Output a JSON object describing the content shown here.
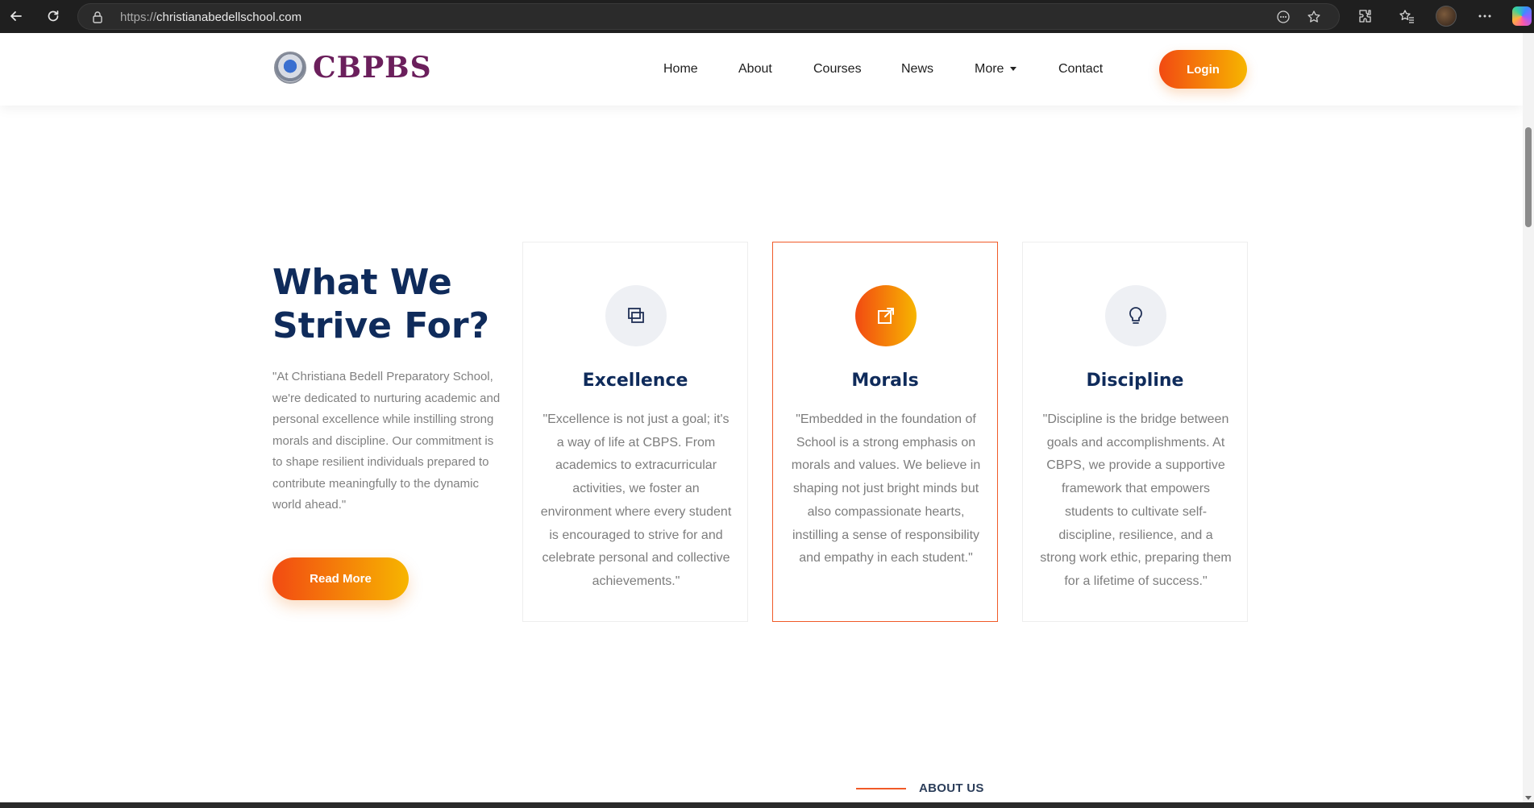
{
  "browser": {
    "url_protocol": "https://",
    "url_host": "christianabedellschool.com",
    "icons": [
      "back-icon",
      "reload-icon",
      "lock-icon",
      "reader-icon",
      "star-icon",
      "extensions-icon",
      "favorites-icon",
      "profile-avatar",
      "more-icon",
      "copilot-icon"
    ]
  },
  "header": {
    "logo_text": "CBPBS",
    "nav": {
      "home": "Home",
      "about": "About",
      "courses": "Courses",
      "news": "News",
      "more": "More",
      "contact": "Contact"
    },
    "login_label": "Login"
  },
  "strive": {
    "title": "What We Strive For?",
    "description": "\"At Christiana Bedell Preparatory School, we're dedicated to nurturing academic and personal excellence while instilling strong morals and discipline. Our commitment is to shape resilient individuals prepared to contribute meaningfully to the dynamic world ahead.\"",
    "read_more_label": "Read More",
    "cards": [
      {
        "title": "Excellence",
        "icon": "layers-icon",
        "text": "\"Excellence is not just a goal; it's a way of life at CBPS. From academics to extracurricular activities, we foster an environment where every student is encouraged to strive for and celebrate personal and collective achievements.\""
      },
      {
        "title": "Morals",
        "icon": "external-link-icon",
        "text": "\"Embedded in the foundation of School is a strong emphasis on morals and values. We believe in shaping not just bright minds but also compassionate hearts, instilling a sense of responsibility and empathy in each student.\""
      },
      {
        "title": "Discipline",
        "icon": "lightbulb-icon",
        "text": "\"Discipline is the bridge between goals and accomplishments. At CBPS, we provide a supportive framework that empowers students to cultivate self-discipline, resilience, and a strong work ethic, preparing them for a lifetime of success.\""
      }
    ]
  },
  "about": {
    "label": "ABOUT US"
  },
  "colors": {
    "navy": "#0f2b5b",
    "accent_start": "#f24a12",
    "accent_end": "#f7b500",
    "logo": "#6b1f5c"
  }
}
